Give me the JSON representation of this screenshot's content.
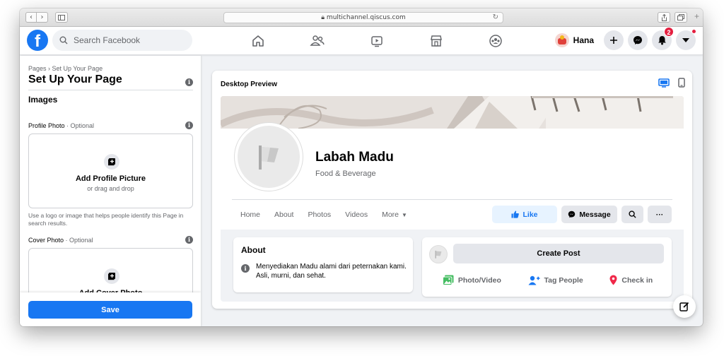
{
  "browser": {
    "url": "multichannel.qiscus.com"
  },
  "fb": {
    "logo_letter": "f",
    "search_placeholder": "Search Facebook",
    "user_name": "Hana",
    "notification_count": "2"
  },
  "setup": {
    "breadcrumb": "Pages › Set Up Your Page",
    "title": "Set Up Your Page",
    "section": "Images",
    "profile_label": "Profile Photo",
    "profile_optional": " · Optional",
    "profile_title": "Add Profile Picture",
    "profile_sub": "or drag and drop",
    "profile_help": "Use a logo or image that helps people identify this Page in search results.",
    "cover_label": "Cover Photo",
    "cover_optional": " · Optional",
    "cover_title": "Add Cover Photo",
    "save_label": "Save"
  },
  "preview": {
    "label": "Desktop Preview",
    "page_name": "Labah Madu",
    "category": "Food & Beverage",
    "tabs": [
      "Home",
      "About",
      "Photos",
      "Videos",
      "More"
    ],
    "like_label": "Like",
    "message_label": "Message",
    "more_dots": "···",
    "about_heading": "About",
    "about_text": "Menyediakan Madu alami dari peternakan kami. Asli, murni, dan sehat.",
    "create_post": "Create Post",
    "post_actions": [
      "Photo/Video",
      "Tag People",
      "Check in"
    ]
  },
  "colors": {
    "accent": "#1877f2",
    "badge": "#e41e3f",
    "photo_green": "#45bd62",
    "checkin_red": "#f02849"
  }
}
